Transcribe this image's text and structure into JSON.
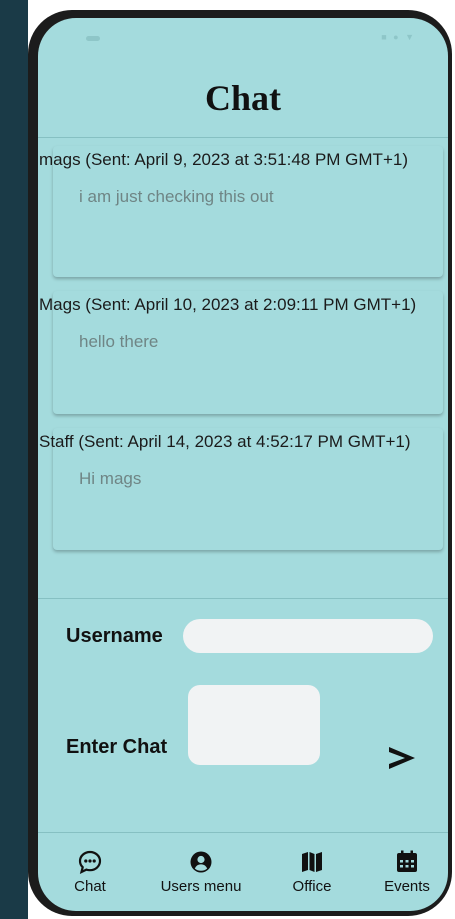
{
  "app": {
    "title": "Chat"
  },
  "status_bar": {
    "icons": "■ ● ▼"
  },
  "messages": [
    {
      "header": "mags (Sent: April 9, 2023 at 3:51:48 PM GMT+1)",
      "text": "i am just checking this out"
    },
    {
      "header": "Mags (Sent: April 10, 2023 at 2:09:11 PM GMT+1)",
      "text": "hello there"
    },
    {
      "header": "Staff (Sent: April 14, 2023 at 4:52:17 PM GMT+1)",
      "text": "Hi mags"
    }
  ],
  "form": {
    "username_label": "Username",
    "username_value": "",
    "chat_label": "Enter Chat",
    "chat_value": ""
  },
  "nav": {
    "items": [
      {
        "label": "Chat",
        "icon": "chat-bubble-icon"
      },
      {
        "label": "Users menu",
        "icon": "user-circle-icon"
      },
      {
        "label": "Office",
        "icon": "map-icon"
      },
      {
        "label": "Events",
        "icon": "calendar-icon"
      }
    ]
  },
  "colors": {
    "background": "#a4dbdd",
    "input_background": "#f1f3f4",
    "divider": "#86c0c2",
    "message_text": "#6f8585",
    "text": "#111111"
  }
}
